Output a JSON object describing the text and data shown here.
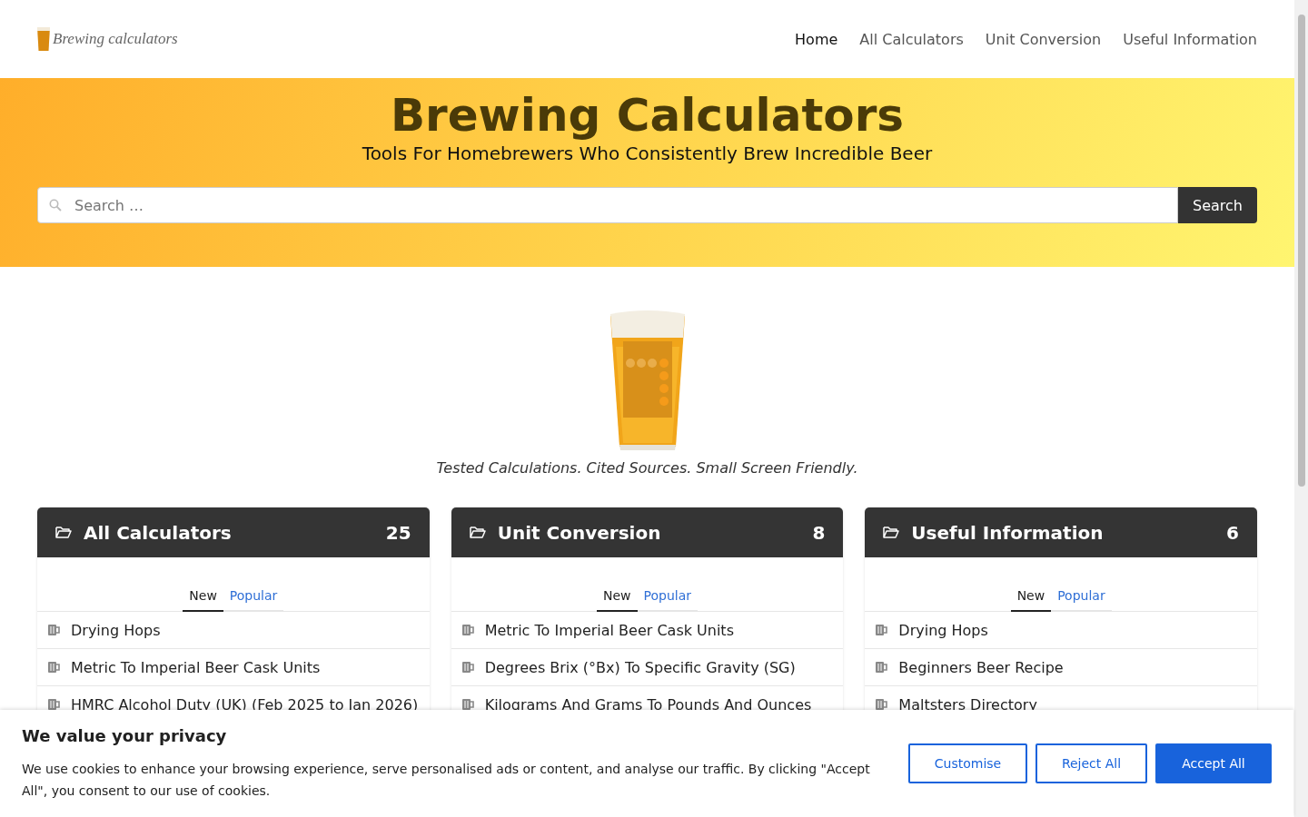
{
  "logo": {
    "text": "Brewing calculators"
  },
  "nav": [
    {
      "label": "Home",
      "selected": true
    },
    {
      "label": "All Calculators",
      "selected": false
    },
    {
      "label": "Unit Conversion",
      "selected": false
    },
    {
      "label": "Useful Information",
      "selected": false
    }
  ],
  "hero": {
    "title": "Brewing Calculators",
    "subtitle": "Tools For Homebrewers Who Consistently Brew Incredible Beer",
    "search": {
      "placeholder": "Search …",
      "button": "Search"
    }
  },
  "feature": {
    "kind": "picture",
    "tagline": "Tested Calculations. Cited Sources. Small Screen Friendly."
  },
  "cards": [
    {
      "title": "All Calculators",
      "count": "25",
      "tabs": [
        {
          "label": "New",
          "selected": true
        },
        {
          "label": "Popular",
          "selected": false
        }
      ],
      "items": [
        "Drying Hops",
        "Metric To Imperial Beer Cask Units",
        "HMRC Alcohol Duty (UK) (Feb 2025 to Jan 2026)"
      ]
    },
    {
      "title": "Unit Conversion",
      "count": "8",
      "tabs": [
        {
          "label": "New",
          "selected": true
        },
        {
          "label": "Popular",
          "selected": false
        }
      ],
      "items": [
        "Metric To Imperial Beer Cask Units",
        "Degrees Brix (°Bx) To Specific Gravity (SG)",
        "Kilograms And Grams To Pounds And Ounces"
      ]
    },
    {
      "title": "Useful Information",
      "count": "6",
      "tabs": [
        {
          "label": "New",
          "selected": true
        },
        {
          "label": "Popular",
          "selected": false
        }
      ],
      "items": [
        "Drying Hops",
        "Beginners Beer Recipe",
        "Maltsters Directory"
      ]
    }
  ],
  "cookie_banner": {
    "title": "We value your privacy",
    "text": "We use cookies to enhance your browsing experience, serve personalised ads or content, and analyse our traffic. By clicking \"Accept All\", you consent to our use of cookies.",
    "buttons": [
      {
        "label": "Customise",
        "kind": "outline"
      },
      {
        "label": "Reject All",
        "kind": "outline"
      },
      {
        "label": "Accept All",
        "kind": "primary"
      }
    ]
  }
}
